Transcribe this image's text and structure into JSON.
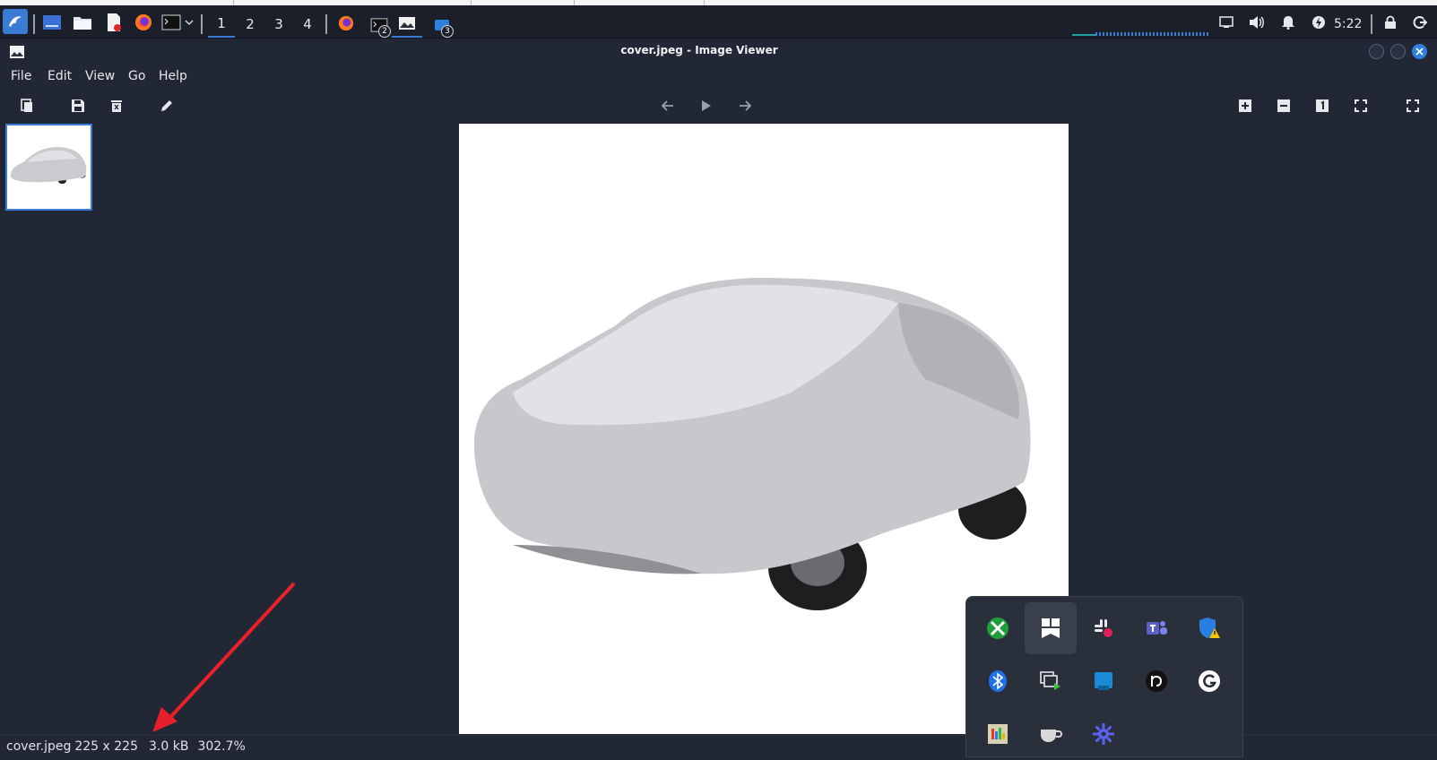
{
  "window": {
    "title": "cover.jpeg - Image Viewer"
  },
  "taskbar": {
    "workspaces": [
      "1",
      "2",
      "3",
      "4"
    ],
    "active_workspace": "1",
    "terminal_badge": "2",
    "app_badge": "3",
    "clock": "5:22"
  },
  "menu": {
    "file": "File",
    "edit": "Edit",
    "view": "View",
    "go": "Go",
    "help": "Help"
  },
  "status": {
    "filename": "cover.jpeg",
    "dimensions": "225 x 225",
    "filesize": "3.0 kB",
    "zoom": "302.7%"
  },
  "colors": {
    "accent": "#3a7bd5",
    "annotation_arrow": "#e8202a",
    "background": "#222736"
  },
  "icons": {
    "taskbar": [
      "kali-dragon-icon",
      "show-desktop-icon",
      "file-manager-icon",
      "text-editor-icon",
      "firefox-icon",
      "terminal-icon",
      "chevron-down-icon",
      "firefox-icon",
      "terminal-icon",
      "image-viewer-icon",
      "app-icon"
    ],
    "tray": [
      "xbox-icon",
      "bookmark-app-icon",
      "slack-icon",
      "teams-icon",
      "defender-warning-icon",
      "bluetooth-icon",
      "display-capture-icon",
      "blue-app-icon",
      "beats-icon",
      "grammarly-icon",
      "color-app-icon",
      "cup-icon",
      "gear-app-icon"
    ]
  }
}
